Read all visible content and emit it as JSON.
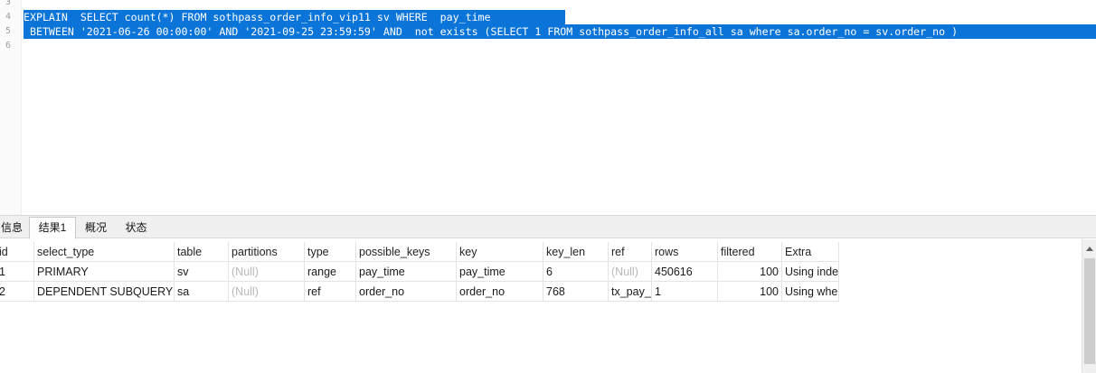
{
  "editor": {
    "line_numbers": [
      "3",
      "4",
      "5",
      "6"
    ],
    "lines": [
      "EXPLAIN  SELECT count(*) FROM sothpass_order_info_vip11 sv WHERE  pay_time ",
      " BETWEEN '2021-06-26 00:00:00' AND '2021-09-25 23:59:59' AND  not exists (SELECT 1 FROM sothpass_order_info_all sa where sa.order_no = sv.order_no )"
    ],
    "selection_color": "#0a74d9"
  },
  "tabs": [
    {
      "label": "信息",
      "active": false
    },
    {
      "label": "结果1",
      "active": true
    },
    {
      "label": "概况",
      "active": false
    },
    {
      "label": "状态",
      "active": false
    }
  ],
  "grid": {
    "columns": [
      "id",
      "select_type",
      "table",
      "partitions",
      "type",
      "possible_keys",
      "key",
      "key_len",
      "ref",
      "rows",
      "filtered",
      "Extra"
    ],
    "rows": [
      [
        "1",
        "PRIMARY",
        "sv",
        "(Null)",
        "range",
        "pay_time",
        "pay_time",
        "6",
        "(Null)",
        "450616",
        "100",
        "Using index"
      ],
      [
        "2",
        "DEPENDENT SUBQUERY",
        "sa",
        "(Null)",
        "ref",
        "order_no",
        "order_no",
        "768",
        "tx_pay_test",
        "1",
        "100",
        "Using where"
      ]
    ]
  },
  "icons": {
    "scroll_up": "arrow-up-icon"
  }
}
